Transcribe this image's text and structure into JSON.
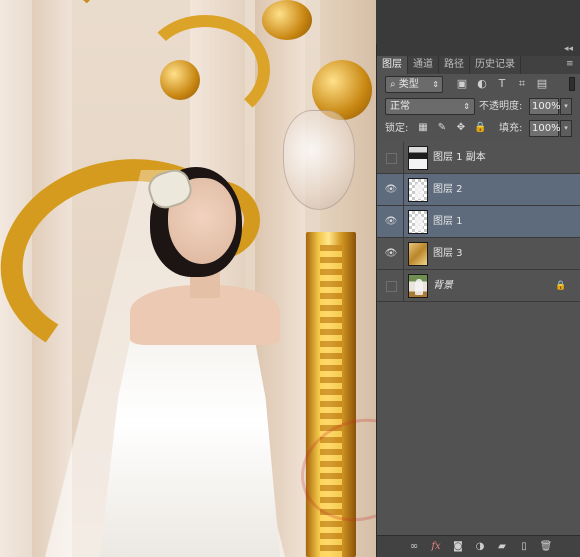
{
  "panel": {
    "collapse_glyph": "◂◂",
    "tabs": [
      {
        "label": "图层",
        "active": true
      },
      {
        "label": "通道",
        "active": false
      },
      {
        "label": "路径",
        "active": false
      },
      {
        "label": "历史记录",
        "active": false
      }
    ],
    "menu_icon": "≡",
    "filter": {
      "search_glyph": "⌕",
      "selected": "类型",
      "icons": [
        "image-filter-icon",
        "adjustment-filter-icon",
        "type-filter-icon",
        "shape-filter-icon",
        "smart-object-filter-icon"
      ],
      "icon_glyphs": [
        "▣",
        "◐",
        "T",
        "⌗",
        "▤"
      ]
    },
    "blend_mode": "正常",
    "opacity_label": "不透明度:",
    "opacity_value": "100%",
    "lock_label": "锁定:",
    "lock_icons": [
      "lock-transparent-pixels-icon",
      "lock-image-pixels-icon",
      "lock-position-icon",
      "lock-all-icon"
    ],
    "lock_glyphs": [
      "▦",
      "✎",
      "✥",
      "🔒"
    ],
    "fill_label": "填充:",
    "fill_value": "100%",
    "layers": [
      {
        "name": "图层 1 副本",
        "visible": false,
        "selected": false,
        "thumb": "t-copy",
        "italic": false,
        "locked": false
      },
      {
        "name": "图层 2",
        "visible": true,
        "selected": true,
        "thumb": "t-trans",
        "italic": false,
        "locked": false
      },
      {
        "name": "图层 1",
        "visible": true,
        "selected": true,
        "thumb": "t-trans",
        "italic": false,
        "locked": false
      },
      {
        "name": "图层 3",
        "visible": true,
        "selected": false,
        "thumb": "t-gold",
        "italic": false,
        "locked": false
      },
      {
        "name": "背景",
        "visible": false,
        "selected": false,
        "thumb": "t-bg",
        "italic": true,
        "locked": true
      }
    ],
    "bottom_icons": [
      {
        "name": "link-layers-icon",
        "glyph": "∞"
      },
      {
        "name": "layer-style-fx-icon",
        "glyph": "fx"
      },
      {
        "name": "add-mask-icon",
        "glyph": "◙"
      },
      {
        "name": "adjustment-layer-icon",
        "glyph": "◑"
      },
      {
        "name": "new-group-icon",
        "glyph": "▰"
      },
      {
        "name": "new-layer-icon",
        "glyph": "▯"
      },
      {
        "name": "delete-layer-icon",
        "glyph": "🗑"
      }
    ]
  }
}
